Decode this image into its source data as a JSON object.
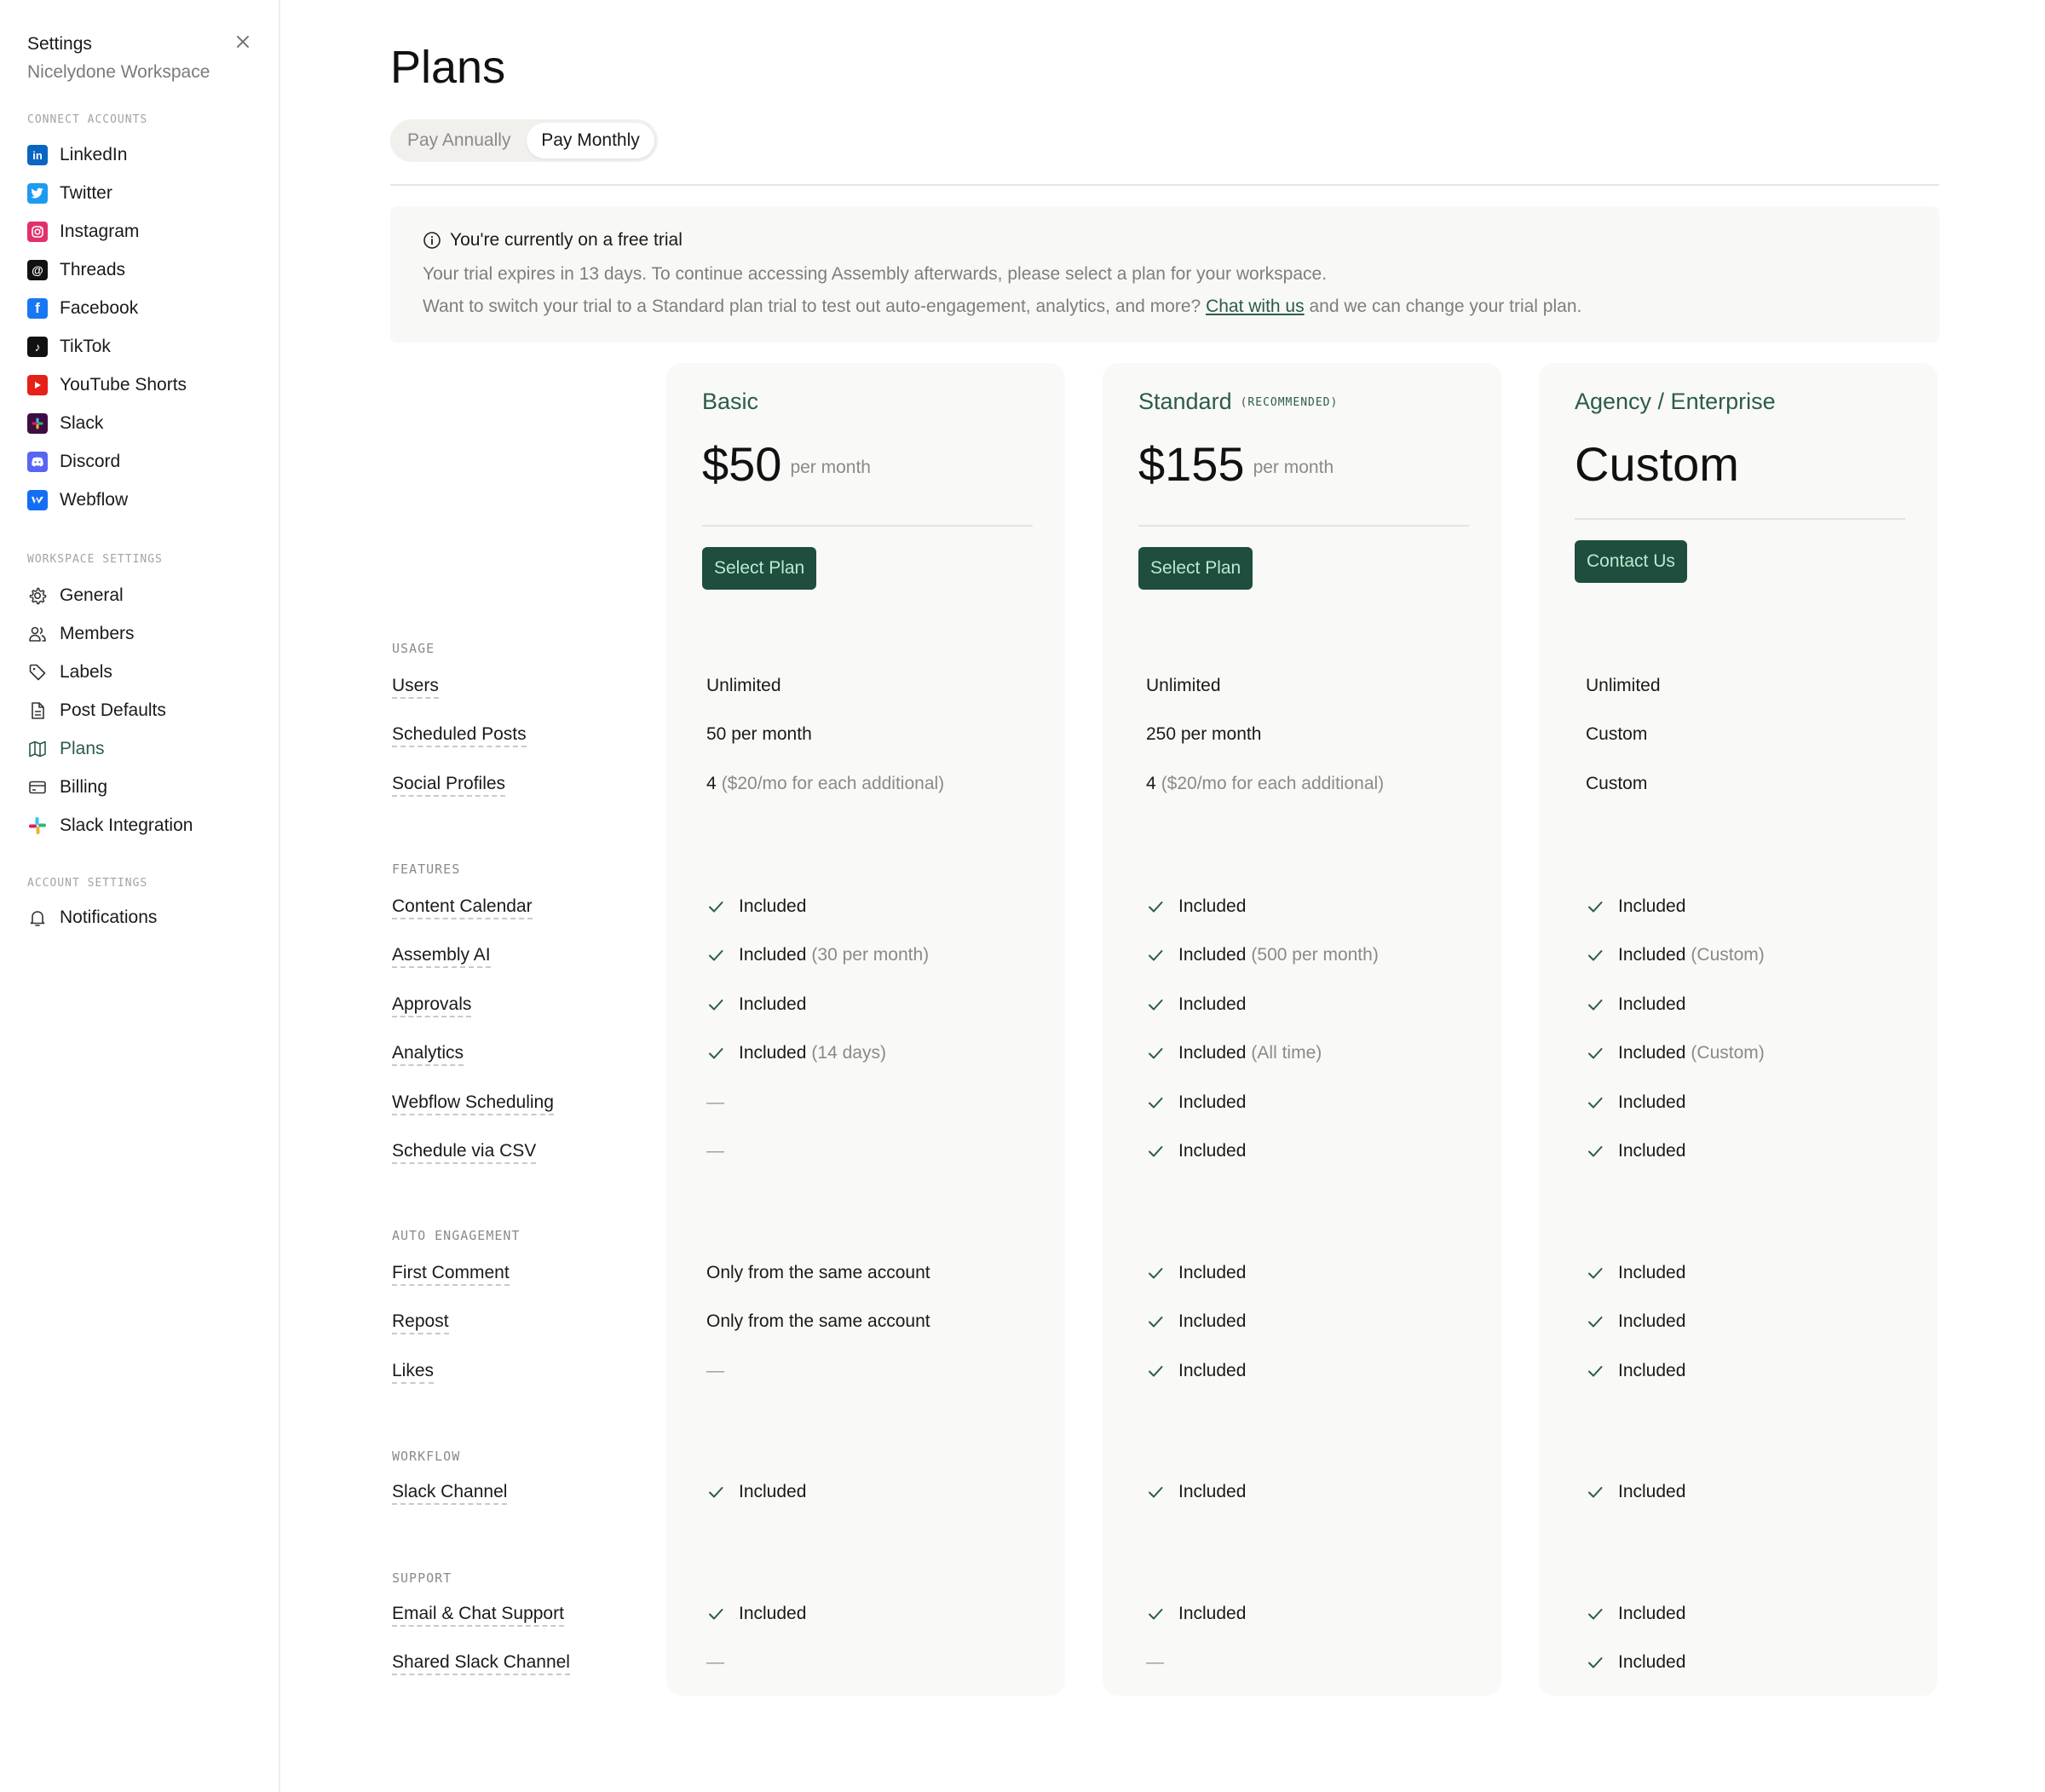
{
  "sidebar": {
    "title": "Settings",
    "workspace": "Nicelydone Workspace",
    "sections": {
      "connect": "CONNECT ACCOUNTS",
      "workspace": "WORKSPACE SETTINGS",
      "account": "ACCOUNT SETTINGS"
    },
    "connect_items": [
      {
        "label": "LinkedIn",
        "icon": "linkedin-icon",
        "color": "#0a66c2"
      },
      {
        "label": "Twitter",
        "icon": "twitter-icon",
        "color": "#1d9bf0"
      },
      {
        "label": "Instagram",
        "icon": "instagram-icon",
        "color": "#e1306c"
      },
      {
        "label": "Threads",
        "icon": "threads-icon",
        "color": "#111111"
      },
      {
        "label": "Facebook",
        "icon": "facebook-icon",
        "color": "#1877f2"
      },
      {
        "label": "TikTok",
        "icon": "tiktok-icon",
        "color": "#111111"
      },
      {
        "label": "YouTube Shorts",
        "icon": "youtube-shorts-icon",
        "color": "#e62117"
      },
      {
        "label": "Slack",
        "icon": "slack-icon",
        "color": "#3f0e40"
      },
      {
        "label": "Discord",
        "icon": "discord-icon",
        "color": "#5865f2"
      },
      {
        "label": "Webflow",
        "icon": "webflow-icon",
        "color": "#146ef5"
      }
    ],
    "workspace_items": [
      {
        "label": "General",
        "icon": "gear-icon"
      },
      {
        "label": "Members",
        "icon": "users-icon"
      },
      {
        "label": "Labels",
        "icon": "tag-icon"
      },
      {
        "label": "Post Defaults",
        "icon": "document-icon"
      },
      {
        "label": "Plans",
        "icon": "map-icon",
        "active": true
      },
      {
        "label": "Billing",
        "icon": "credit-card-icon"
      },
      {
        "label": "Slack Integration",
        "icon": "slack-color-icon"
      }
    ],
    "account_items": [
      {
        "label": "Notifications",
        "icon": "bell-icon"
      }
    ]
  },
  "main": {
    "title": "Plans",
    "billing_toggle": {
      "annual": "Pay Annually",
      "monthly": "Pay Monthly",
      "selected": "monthly"
    },
    "trial": {
      "heading": "You're currently on a free trial",
      "line1": "Your trial expires in 13 days. To continue accessing Assembly afterwards, please select a plan for your workspace.",
      "line2_before": "Want to switch your trial to a Standard plan trial to test out auto-engagement, analytics, and more? ",
      "line2_link": "Chat with us",
      "line2_after": " and we can change your trial plan."
    },
    "plans": {
      "basic": {
        "name": "Basic",
        "price": "$50",
        "period": "per month",
        "cta": "Select Plan"
      },
      "standard": {
        "name": "Standard",
        "badge": "(RECOMMENDED)",
        "price": "$155",
        "period": "per month",
        "cta": "Select Plan"
      },
      "enterprise": {
        "name": "Agency / Enterprise",
        "price": "Custom",
        "cta": "Contact Us"
      }
    },
    "sections": {
      "usage": "USAGE",
      "features": "FEATURES",
      "auto_engagement": "AUTO ENGAGEMENT",
      "workflow": "WORKFLOW",
      "support": "SUPPORT"
    },
    "rows": {
      "users": {
        "label": "Users",
        "basic": "Unlimited",
        "standard": "Unlimited",
        "enterprise": "Unlimited"
      },
      "scheduled_posts": {
        "label": "Scheduled Posts",
        "basic": "50 per month",
        "standard": "250 per month",
        "enterprise": "Custom"
      },
      "social_profiles": {
        "label": "Social Profiles",
        "basic": "4",
        "basic_note": "($20/mo for each additional)",
        "standard": "4",
        "standard_note": "($20/mo for each additional)",
        "enterprise": "Custom"
      },
      "content_calendar": {
        "label": "Content Calendar",
        "basic": "Included",
        "standard": "Included",
        "enterprise": "Included"
      },
      "assembly_ai": {
        "label": "Assembly AI",
        "basic": "Included",
        "basic_note": "(30 per month)",
        "standard": "Included",
        "standard_note": "(500 per month)",
        "enterprise": "Included",
        "enterprise_note": "(Custom)"
      },
      "approvals": {
        "label": "Approvals",
        "basic": "Included",
        "standard": "Included",
        "enterprise": "Included"
      },
      "analytics": {
        "label": "Analytics",
        "basic": "Included",
        "basic_note": "(14 days)",
        "standard": "Included",
        "standard_note": "(All time)",
        "enterprise": "Included",
        "enterprise_note": "(Custom)"
      },
      "webflow_scheduling": {
        "label": "Webflow Scheduling",
        "basic": "—",
        "standard": "Included",
        "enterprise": "Included"
      },
      "schedule_csv": {
        "label": "Schedule via CSV",
        "basic": "—",
        "standard": "Included",
        "enterprise": "Included"
      },
      "first_comment": {
        "label": "First Comment",
        "basic": "Only from the same account",
        "standard": "Included",
        "enterprise": "Included"
      },
      "repost": {
        "label": "Repost",
        "basic": "Only from the same account",
        "standard": "Included",
        "enterprise": "Included"
      },
      "likes": {
        "label": "Likes",
        "basic": "—",
        "standard": "Included",
        "enterprise": "Included"
      },
      "slack_channel": {
        "label": "Slack Channel",
        "basic": "Included",
        "standard": "Included",
        "enterprise": "Included"
      },
      "email_chat_support": {
        "label": "Email & Chat Support",
        "basic": "Included",
        "standard": "Included",
        "enterprise": "Included"
      },
      "shared_slack_channel": {
        "label": "Shared Slack Channel",
        "basic": "—",
        "standard": "—",
        "enterprise": "Included"
      }
    }
  }
}
